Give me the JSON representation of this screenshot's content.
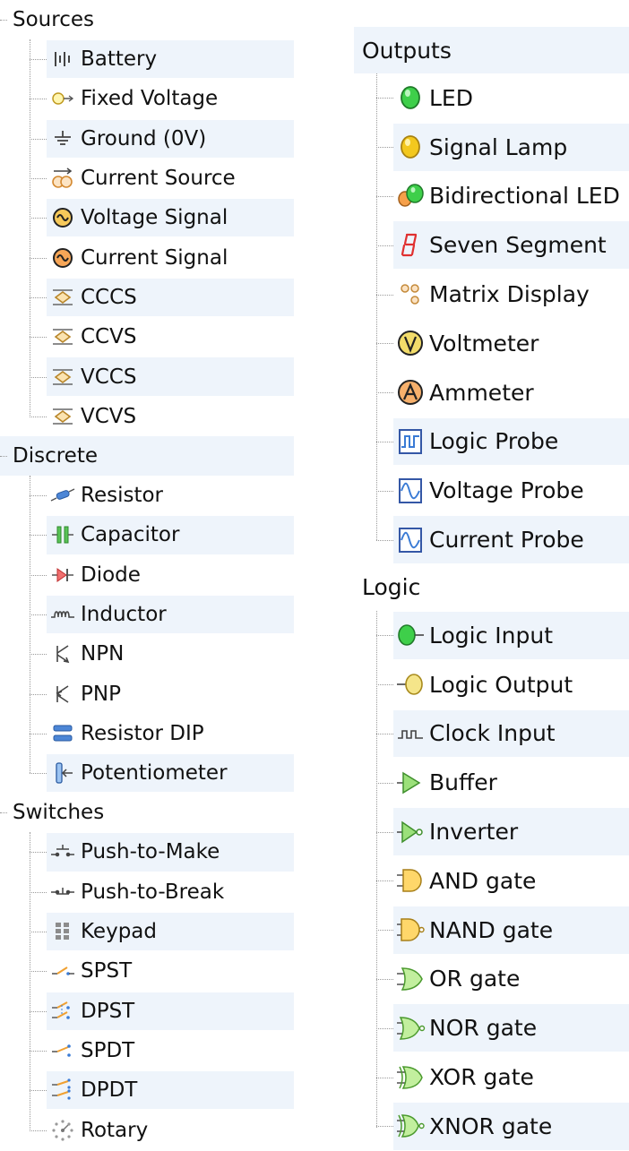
{
  "left_panel": {
    "categories": [
      {
        "label": "Sources",
        "items": [
          {
            "label": "Battery",
            "icon": "battery-icon"
          },
          {
            "label": "Fixed Voltage",
            "icon": "fixed-voltage-icon"
          },
          {
            "label": "Ground (0V)",
            "icon": "ground-icon"
          },
          {
            "label": "Current Source",
            "icon": "current-source-icon"
          },
          {
            "label": "Voltage Signal",
            "icon": "voltage-signal-icon"
          },
          {
            "label": "Current Signal",
            "icon": "current-signal-icon"
          },
          {
            "label": "CCCS",
            "icon": "cccs-icon"
          },
          {
            "label": "CCVS",
            "icon": "ccvs-icon"
          },
          {
            "label": "VCCS",
            "icon": "vccs-icon"
          },
          {
            "label": "VCVS",
            "icon": "vcvs-icon"
          }
        ]
      },
      {
        "label": "Discrete",
        "items": [
          {
            "label": "Resistor",
            "icon": "resistor-icon"
          },
          {
            "label": "Capacitor",
            "icon": "capacitor-icon"
          },
          {
            "label": "Diode",
            "icon": "diode-icon"
          },
          {
            "label": "Inductor",
            "icon": "inductor-icon"
          },
          {
            "label": "NPN",
            "icon": "npn-icon"
          },
          {
            "label": "PNP",
            "icon": "pnp-icon"
          },
          {
            "label": "Resistor DIP",
            "icon": "resistor-dip-icon"
          },
          {
            "label": "Potentiometer",
            "icon": "potentiometer-icon"
          }
        ]
      },
      {
        "label": "Switches",
        "items": [
          {
            "label": "Push-to-Make",
            "icon": "push-to-make-icon"
          },
          {
            "label": "Push-to-Break",
            "icon": "push-to-break-icon"
          },
          {
            "label": "Keypad",
            "icon": "keypad-icon"
          },
          {
            "label": "SPST",
            "icon": "spst-icon"
          },
          {
            "label": "DPST",
            "icon": "dpst-icon"
          },
          {
            "label": "SPDT",
            "icon": "spdt-icon"
          },
          {
            "label": "DPDT",
            "icon": "dpdt-icon"
          },
          {
            "label": "Rotary",
            "icon": "rotary-icon"
          }
        ]
      }
    ]
  },
  "right_panel": {
    "categories": [
      {
        "label": "Outputs",
        "items": [
          {
            "label": "LED",
            "icon": "led-icon"
          },
          {
            "label": "Signal Lamp",
            "icon": "signal-lamp-icon"
          },
          {
            "label": "Bidirectional LED",
            "icon": "bidirectional-led-icon"
          },
          {
            "label": "Seven Segment",
            "icon": "seven-segment-icon"
          },
          {
            "label": "Matrix Display",
            "icon": "matrix-display-icon"
          },
          {
            "label": "Voltmeter",
            "icon": "voltmeter-icon"
          },
          {
            "label": "Ammeter",
            "icon": "ammeter-icon"
          },
          {
            "label": "Logic Probe",
            "icon": "logic-probe-icon"
          },
          {
            "label": "Voltage Probe",
            "icon": "voltage-probe-icon"
          },
          {
            "label": "Current Probe",
            "icon": "current-probe-icon"
          }
        ]
      },
      {
        "label": "Logic",
        "items": [
          {
            "label": "Logic Input",
            "icon": "logic-input-icon"
          },
          {
            "label": "Logic Output",
            "icon": "logic-output-icon"
          },
          {
            "label": "Clock Input",
            "icon": "clock-input-icon"
          },
          {
            "label": "Buffer",
            "icon": "buffer-icon"
          },
          {
            "label": "Inverter",
            "icon": "inverter-icon"
          },
          {
            "label": "AND gate",
            "icon": "and-gate-icon"
          },
          {
            "label": "NAND gate",
            "icon": "nand-gate-icon"
          },
          {
            "label": "OR gate",
            "icon": "or-gate-icon"
          },
          {
            "label": "NOR gate",
            "icon": "nor-gate-icon"
          },
          {
            "label": "XOR gate",
            "icon": "xor-gate-icon"
          },
          {
            "label": "XNOR gate",
            "icon": "xnor-gate-icon"
          }
        ]
      }
    ]
  },
  "colors": {
    "row_alt_bg": "#eef4fb",
    "tree_line": "#9a9a9a",
    "led_green": "#3ecf4a",
    "lamp_yellow": "#f3c81e",
    "seven_segment_red": "#e03030",
    "meter_yellow": "#f2dc6a",
    "meter_orange": "#f6b06c",
    "source_orange": "#f19a32",
    "switch_orange": "#f0a030",
    "switch_blue": "#3a7bd5",
    "diode_red": "#e04848",
    "resistor_blue": "#4c86d6",
    "gate_yellow": "#ffd76a",
    "buffer_green": "#9be07a"
  }
}
